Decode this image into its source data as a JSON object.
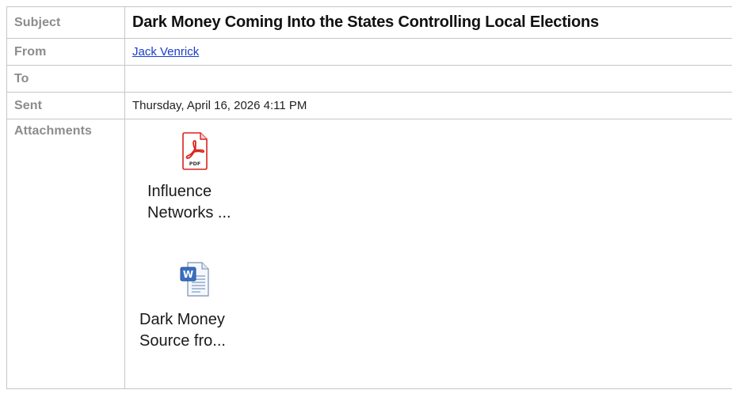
{
  "header": {
    "subject_label": "Subject",
    "subject": "Dark Money Coming Into the States Controlling Local Elections",
    "from_label": "From",
    "from": "Jack Venrick",
    "to_label": "To",
    "to": "",
    "sent_label": "Sent",
    "sent": "Thursday, April 16, 2026 4:11 PM",
    "attachments_label": "Attachments"
  },
  "attachments": [
    {
      "icon": "pdf-file-icon",
      "name_line1": "Influence",
      "name_line2": "Networks ..."
    },
    {
      "icon": "word-document-icon",
      "name_line1": "Dark Money",
      "name_line2": "Source fro..."
    }
  ],
  "colors": {
    "label": "#8c8c8c",
    "link": "#1a3ec8",
    "border": "#c6c6c6",
    "pdf_red": "#d9241c"
  }
}
